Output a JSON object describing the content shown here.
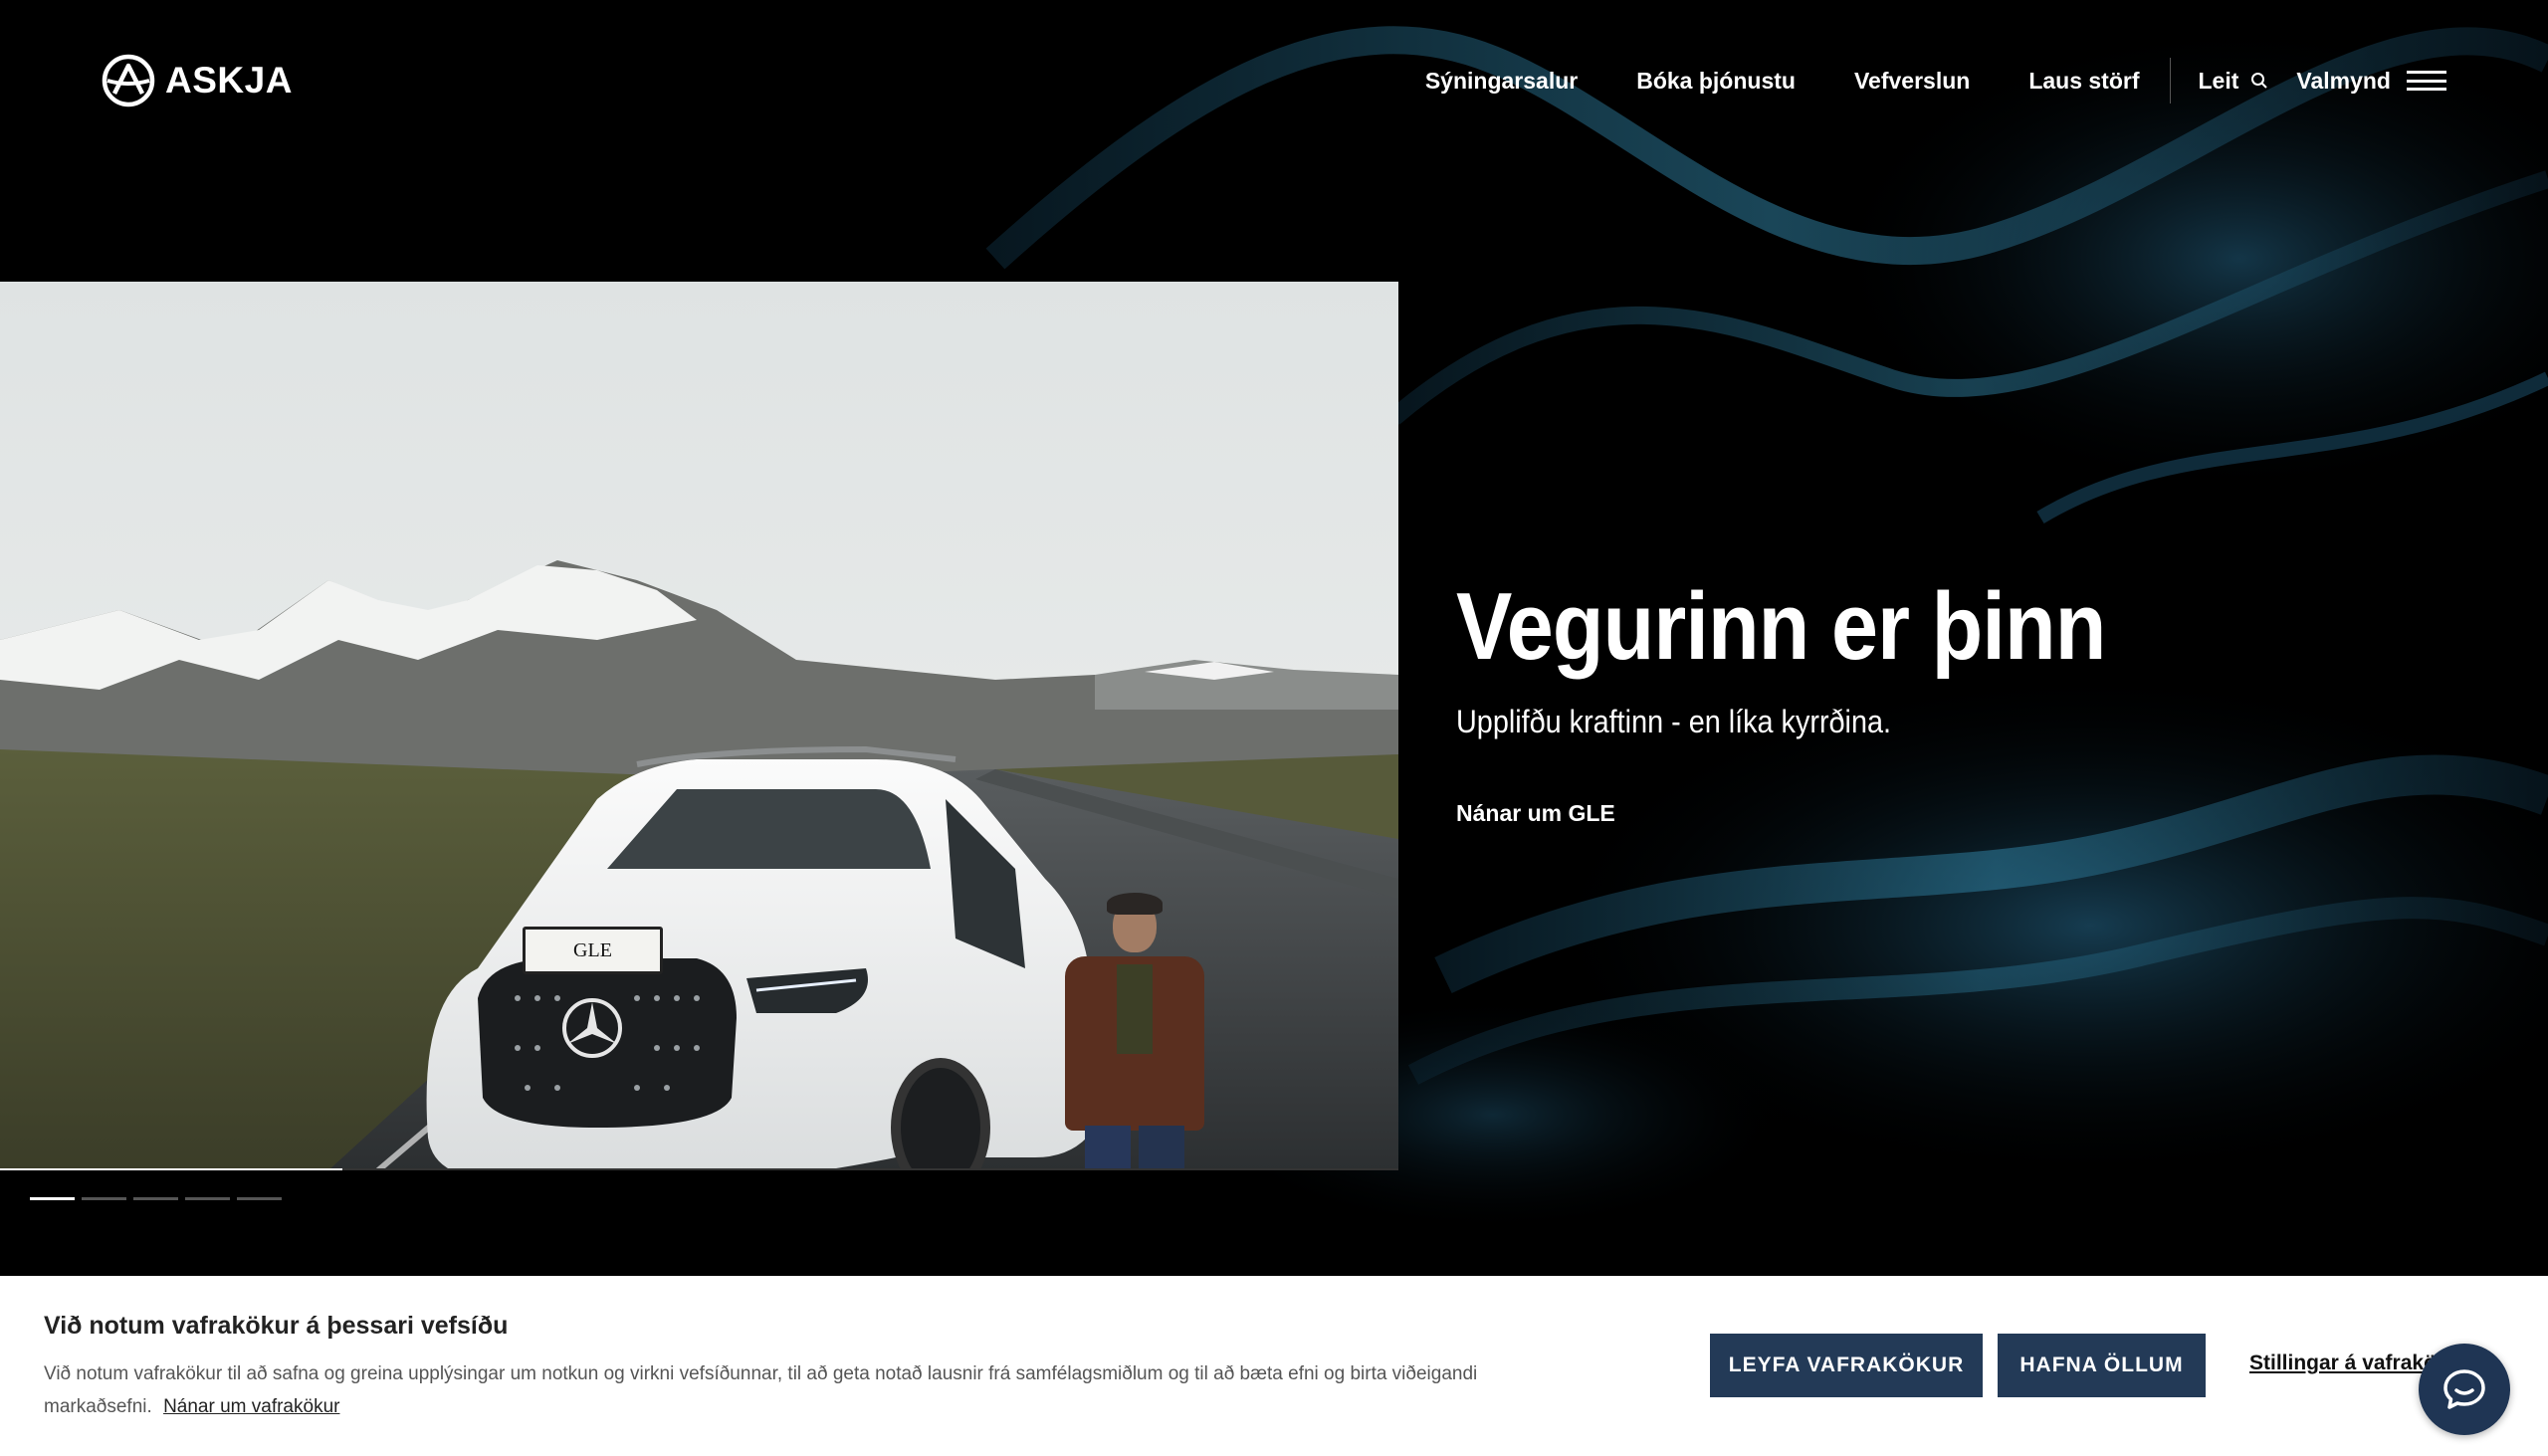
{
  "brand": {
    "name": "ASKJA"
  },
  "nav": {
    "items": [
      {
        "label": "Sýningarsalur"
      },
      {
        "label": "Bóka þjónustu"
      },
      {
        "label": "Vefverslun"
      },
      {
        "label": "Laus störf"
      }
    ],
    "search_label": "Leit",
    "menu_label": "Valmynd"
  },
  "hero": {
    "title": "Vegurinn er þinn",
    "subtitle": "Upplifðu kraftinn - en líka kyrrðina.",
    "cta": "Nánar um GLE",
    "plate_text": "GLE",
    "slide_count": 5,
    "active_slide": 1
  },
  "cookie_banner": {
    "title": "Við notum vafrakökur á þessari vefsíðu",
    "text": "Við notum vafrakökur til að safna og greina upplýsingar um notkun og virkni vefsíðunnar, til að geta notað lausnir frá samfélagsmiðlum og til að bæta efni og birta viðeigandi markaðsefni.",
    "link": "Nánar um vafrakökur",
    "allow_button": "LEYFA VAFRAKÖKUR",
    "deny_button": "HAFNA ÖLLUM",
    "settings_link": "Stillingar á vafrakökum"
  },
  "colors": {
    "background": "#000000",
    "button": "#233a57",
    "chat": "#1f3554"
  }
}
